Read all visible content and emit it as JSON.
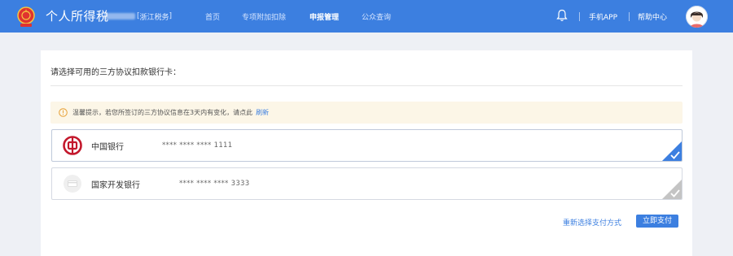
{
  "header": {
    "app_title": "个人所得税",
    "region_left": "[",
    "region_name": "浙江税务",
    "region_right": "]",
    "nav": [
      {
        "label": "首页",
        "active": false
      },
      {
        "label": "专项附加扣除",
        "active": false
      },
      {
        "label": "申报管理",
        "active": true
      },
      {
        "label": "公众查询",
        "active": false
      }
    ],
    "links": {
      "app": "手机APP",
      "help": "帮助中心"
    },
    "icons": {
      "emblem": "tax-emblem-icon",
      "bell": "bell-icon",
      "avatar": "user-avatar"
    }
  },
  "main": {
    "title": "请选择可用的三方协议扣款银行卡：",
    "notice": {
      "text": "温馨提示，若您所签订的三方协议信息在3天内有变化，请点此",
      "link": "刷新",
      "icon": "info-circle-icon"
    },
    "banks": [
      {
        "name": "中国银行",
        "card_number": "**** **** **** 1111",
        "selected": true,
        "icon": "boc-logo-icon"
      },
      {
        "name": "国家开发银行",
        "card_number": "**** **** **** 3333",
        "selected": false,
        "icon": "bank-card-icon"
      }
    ],
    "actions": {
      "reselect": "重新选择支付方式",
      "pay": "立即支付"
    }
  },
  "colors": {
    "header_bg": "#3c7fe0",
    "accent": "#3c7fe0",
    "notice_bg": "#fcf6e7",
    "boc_red": "#c3182c",
    "selected_corner": "#3c7fe0",
    "unselected_corner": "#b8b8b8"
  }
}
